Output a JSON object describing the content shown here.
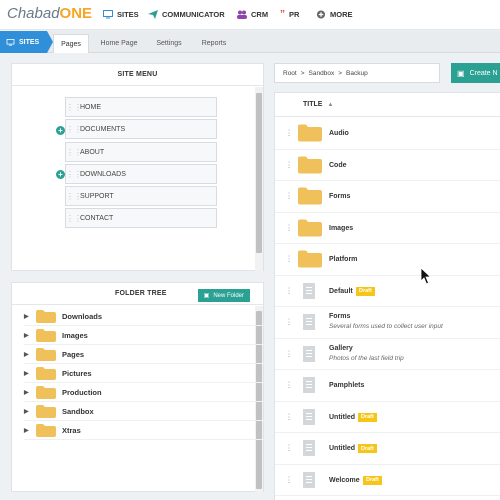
{
  "app": {
    "logo_part1": "Chabad",
    "logo_part2": "ONE"
  },
  "topnav": [
    {
      "label": "SITES",
      "icon": "monitor-icon"
    },
    {
      "label": "COMMUNICATOR",
      "icon": "paper-plane-icon"
    },
    {
      "label": "CRM",
      "icon": "users-icon"
    },
    {
      "label": "PR",
      "icon": "quote-icon"
    },
    {
      "label": "MORE",
      "icon": "plus-circle-icon"
    }
  ],
  "tabstrip": {
    "sites_label": "SITES",
    "tabs": [
      "Pages",
      "Home Page",
      "Settings",
      "Reports"
    ],
    "active_tab": "Pages"
  },
  "site_menu": {
    "title": "SITE MENU",
    "items": [
      {
        "label": "HOME",
        "expandable": false
      },
      {
        "label": "DOCUMENTS",
        "expandable": true
      },
      {
        "label": "ABOUT",
        "expandable": false
      },
      {
        "label": "DOWNLOADS",
        "expandable": true
      },
      {
        "label": "SUPPORT",
        "expandable": false
      },
      {
        "label": "CONTACT",
        "expandable": false
      }
    ]
  },
  "folder_tree": {
    "title": "FOLDER TREE",
    "new_folder_label": "New Folder",
    "items": [
      "Downloads",
      "Images",
      "Pages",
      "Pictures",
      "Production",
      "Sandbox",
      "Xtras"
    ]
  },
  "breadcrumb": {
    "parts": [
      "Root",
      "Sandbox",
      "Backup"
    ],
    "separator": ">"
  },
  "create_button": "Create N",
  "list": {
    "column_title": "TITLE",
    "rows": [
      {
        "title": "Audio",
        "type": "folder"
      },
      {
        "title": "Code",
        "type": "folder"
      },
      {
        "title": "Forms",
        "type": "folder"
      },
      {
        "title": "Images",
        "type": "folder"
      },
      {
        "title": "Platform",
        "type": "folder"
      },
      {
        "title": "Default",
        "type": "page",
        "badge": "Draft"
      },
      {
        "title": "Forms",
        "type": "page",
        "subtitle": "Several forms used to collect user input"
      },
      {
        "title": "Gallery",
        "type": "page",
        "subtitle": "Photos of the last field trip"
      },
      {
        "title": "Pamphlets",
        "type": "page"
      },
      {
        "title": "Untitled",
        "type": "page",
        "badge": "Draft"
      },
      {
        "title": "Untitled",
        "type": "page",
        "badge": "Draft"
      },
      {
        "title": "Welcome",
        "type": "page",
        "badge": "Draft"
      }
    ]
  },
  "colors": {
    "accent_teal": "#2ba193",
    "sites_blue": "#2f8fd8",
    "folder_yellow": "#f0c05a",
    "draft_badge": "#f5c518",
    "logo_orange": "#f5a623"
  }
}
